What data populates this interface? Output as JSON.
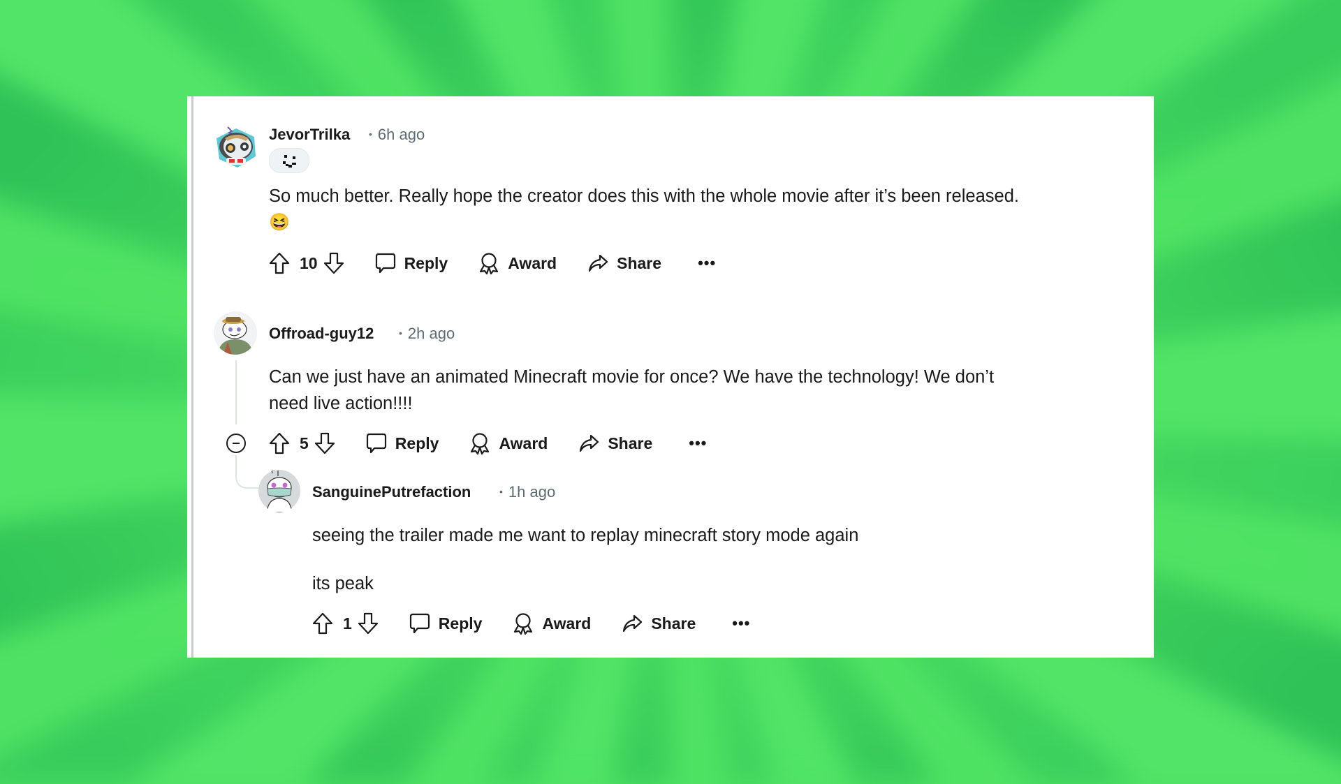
{
  "colors": {
    "background_green": "#4ee163",
    "card": "#ffffff",
    "text": "#1a1a1b",
    "meta": "#5c6c74",
    "thread_line": "#dfe3e5"
  },
  "comments": [
    {
      "username": "JevorTrilka",
      "time": "6h ago",
      "avatar_icon": "snoo-avatar-panda-gamer",
      "flair_icon": "pixel-smiley-flair",
      "body_lines": [
        "So much better. Really hope the creator does this with the whole movie after it’s been released.",
        "😆"
      ],
      "votes": "10",
      "actions": {
        "reply": "Reply",
        "award": "Award",
        "share": "Share",
        "more": "•••"
      }
    },
    {
      "username": "Offroad-guy12",
      "time": "2h ago",
      "avatar_icon": "snoo-avatar-hat",
      "body_lines": [
        "Can we just have an animated Minecraft movie for once? We have the technology! We don’t",
        "need live action!!!!"
      ],
      "votes": "5",
      "actions": {
        "reply": "Reply",
        "award": "Award",
        "share": "Share",
        "more": "•••"
      }
    },
    {
      "username": "SanguinePutrefaction",
      "time": "1h ago",
      "avatar_icon": "snoo-avatar-mask",
      "body_lines": [
        "seeing the trailer made me want to replay minecraft story mode again",
        "its peak"
      ],
      "votes": "1",
      "actions": {
        "reply": "Reply",
        "award": "Award",
        "share": "Share",
        "more": "•••"
      }
    }
  ]
}
